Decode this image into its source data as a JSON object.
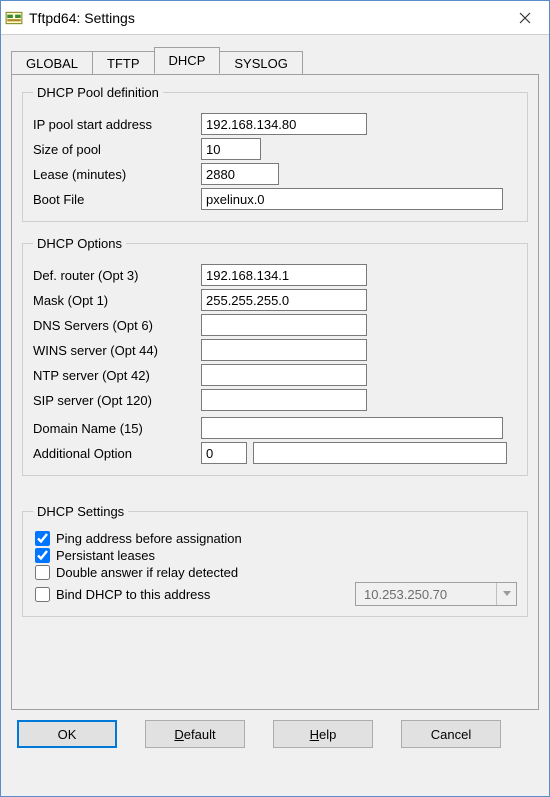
{
  "window": {
    "title": "Tftpd64: Settings"
  },
  "tabs": {
    "global": "GLOBAL",
    "tftp": "TFTP",
    "dhcp": "DHCP",
    "syslog": "SYSLOG",
    "active": "dhcp"
  },
  "pool": {
    "legend": "DHCP Pool definition",
    "items": {
      "ip_start": {
        "label": "IP pool start address",
        "value": "192.168.134.80"
      },
      "size": {
        "label": "Size of pool",
        "value": "10"
      },
      "lease": {
        "label": "Lease (minutes)",
        "value": "2880"
      },
      "bootfile": {
        "label": "Boot File",
        "value": "pxelinux.0"
      }
    }
  },
  "options": {
    "legend": "DHCP Options",
    "items": {
      "router": {
        "label": "Def. router (Opt 3)",
        "value": "192.168.134.1"
      },
      "mask": {
        "label": "Mask (Opt 1)",
        "value": "255.255.255.0"
      },
      "dns": {
        "label": "DNS Servers (Opt 6)",
        "value": ""
      },
      "wins": {
        "label": "WINS server (Opt 44)",
        "value": ""
      },
      "ntp": {
        "label": "NTP server (Opt 42)",
        "value": ""
      },
      "sip": {
        "label": "SIP server (Opt 120)",
        "value": ""
      },
      "domain": {
        "label": "Domain Name (15)",
        "value": ""
      },
      "addl": {
        "label": "Additional Option",
        "num": "0",
        "value": ""
      }
    }
  },
  "settings": {
    "legend": "DHCP Settings",
    "ping": {
      "label": "Ping address before assignation",
      "checked": true
    },
    "persist": {
      "label": "Persistant leases",
      "checked": true
    },
    "double": {
      "label": "Double answer if relay detected",
      "checked": false
    },
    "bind": {
      "label": "Bind DHCP to this address",
      "checked": false,
      "value": "10.253.250.70"
    }
  },
  "buttons": {
    "ok": "OK",
    "default": "efault",
    "default_pre": "D",
    "help": "elp",
    "help_pre": "H",
    "cancel": "Cancel"
  }
}
